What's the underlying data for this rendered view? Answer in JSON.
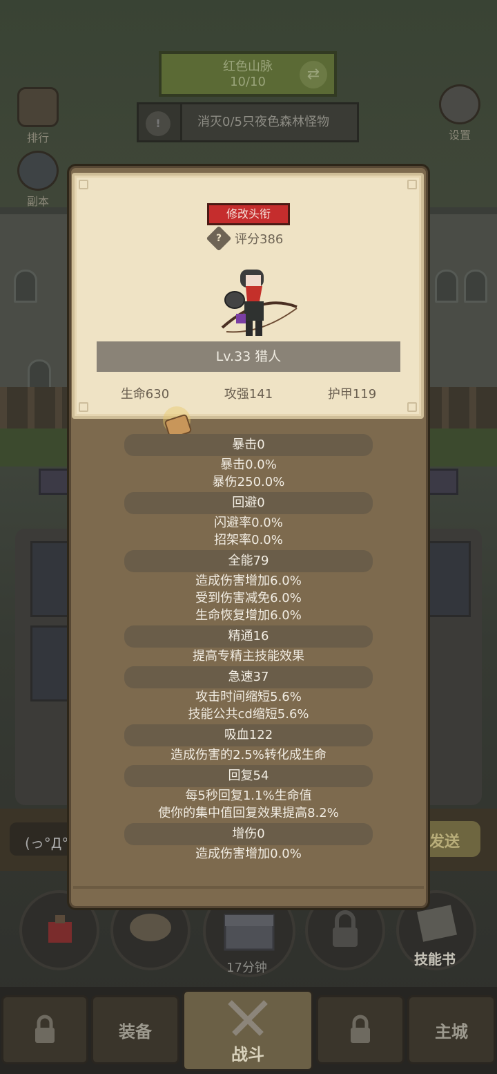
{
  "background": {
    "map_name": "红色山脉",
    "map_progress": "10/10",
    "quest_text": "消灭0/5只夜色森林怪物",
    "side_left": [
      "排行",
      "副本"
    ],
    "side_right": [
      "设置"
    ],
    "chat_placeholder": "(っ°Д°",
    "send_label": "发送",
    "timer_label": "17分钟",
    "skillbook_label": "技能书",
    "tabs": [
      "装备",
      "战斗",
      "主城"
    ]
  },
  "profile": {
    "change_title_button": "修改头衔",
    "score_label": "评分386",
    "level_class": "Lv.33 猎人",
    "hp": "生命630",
    "attack": "攻强141",
    "armor": "护甲119"
  },
  "stats": [
    {
      "header": "暴击0",
      "lines": [
        "暴击0.0%",
        "暴伤250.0%"
      ]
    },
    {
      "header": "回避0",
      "lines": [
        "闪避率0.0%",
        "招架率0.0%"
      ]
    },
    {
      "header": "全能79",
      "lines": [
        "造成伤害增加6.0%",
        "受到伤害减免6.0%",
        "生命恢复增加6.0%"
      ]
    },
    {
      "header": "精通16",
      "lines": [
        "提高专精主技能效果"
      ]
    },
    {
      "header": "急速37",
      "lines": [
        "攻击时间缩短5.6%",
        "技能公共cd缩短5.6%"
      ]
    },
    {
      "header": "吸血122",
      "lines": [
        "造成伤害的2.5%转化成生命"
      ]
    },
    {
      "header": "回复54",
      "lines": [
        "每5秒回复1.1%生命值",
        "使你的集中值回复效果提高8.2%"
      ]
    },
    {
      "header": "增伤0",
      "lines": [
        "造成伤害增加0.0%"
      ]
    }
  ]
}
